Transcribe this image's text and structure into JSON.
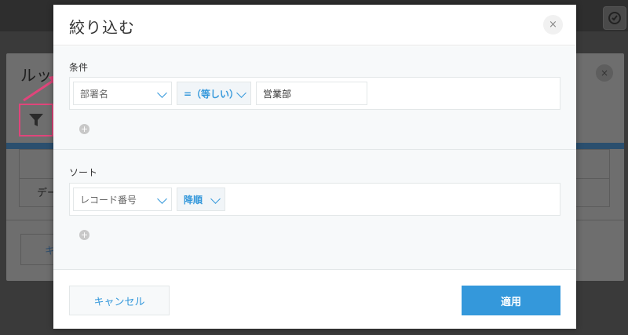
{
  "background": {
    "dialog_title": "ルッ",
    "table_cell": "デー",
    "button_label": "キ",
    "filter_icon": "funnel-icon",
    "highlight_color": "#e0457b"
  },
  "modal": {
    "title": "絞り込む",
    "close_label": "×",
    "conditions": {
      "label": "条件",
      "field_value": "部署名",
      "operator_value": "=（等しい）",
      "input_value": "営業部",
      "add_icon": "plus-circle-icon"
    },
    "sort": {
      "label": "ソート",
      "field_value": "レコード番号",
      "order_value": "降順",
      "add_icon": "plus-circle-icon"
    },
    "footer": {
      "cancel_label": "キャンセル",
      "apply_label": "適用"
    }
  },
  "colors": {
    "accent": "#3498db",
    "arrow": "#e0457b"
  }
}
